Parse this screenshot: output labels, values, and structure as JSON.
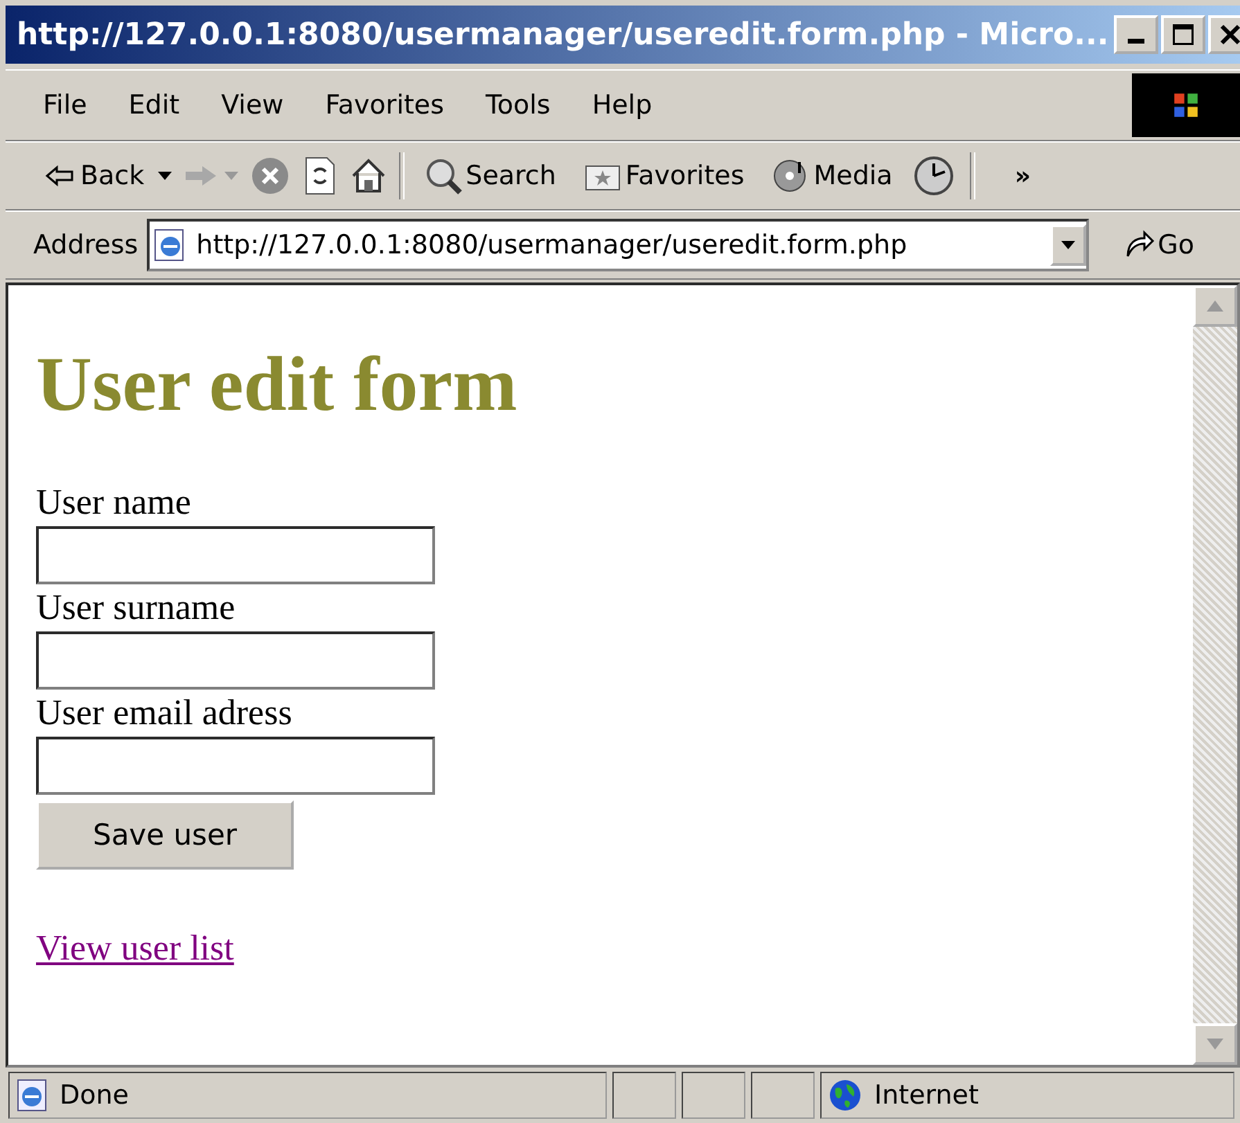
{
  "window": {
    "title": "http://127.0.0.1:8080/usermanager/useredit.form.php - Micro..."
  },
  "menu": [
    {
      "label": "File"
    },
    {
      "label": "Edit"
    },
    {
      "label": "View"
    },
    {
      "label": "Favorites"
    },
    {
      "label": "Tools"
    },
    {
      "label": "Help"
    }
  ],
  "toolbar": {
    "back": "Back",
    "search": "Search",
    "favorites": "Favorites",
    "media": "Media",
    "more": "»"
  },
  "address_bar": {
    "label": "Address",
    "url": "http://127.0.0.1:8080/usermanager/useredit.form.php",
    "go": "Go"
  },
  "page": {
    "heading": "User edit form",
    "fields": [
      {
        "label": "User name"
      },
      {
        "label": "User surname"
      },
      {
        "label": "User email adress"
      }
    ],
    "submit": "Save user",
    "link": {
      "text": "View user list",
      "visited": true
    }
  },
  "status_bar": {
    "status": "Done",
    "zone": "Internet"
  }
}
